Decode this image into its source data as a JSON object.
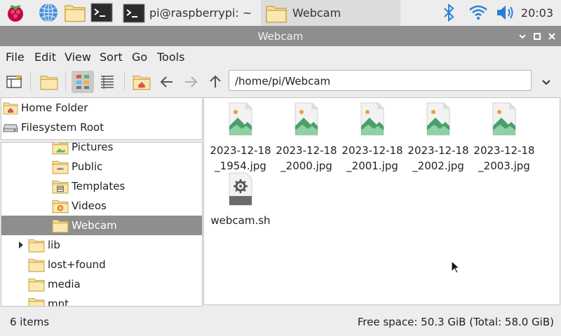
{
  "taskbar": {
    "tasks": [
      {
        "label": "pi@raspberrypi: ~"
      },
      {
        "label": "Webcam"
      }
    ],
    "clock": "20:03",
    "icons": [
      "raspberry-icon",
      "globe-icon",
      "folder-icon",
      "terminal-icon",
      "bluetooth-icon",
      "wifi-icon",
      "volume-icon"
    ]
  },
  "window": {
    "title": "Webcam"
  },
  "menu": {
    "items": [
      "File",
      "Edit",
      "View",
      "Sort",
      "Go",
      "Tools"
    ]
  },
  "toolbar": {
    "path": "/home/pi/Webcam"
  },
  "places": [
    {
      "label": "Home Folder"
    },
    {
      "label": "Filesystem Root"
    }
  ],
  "tree": [
    {
      "label": "Pictures"
    },
    {
      "label": "Public"
    },
    {
      "label": "Templates"
    },
    {
      "label": "Videos"
    },
    {
      "label": "Webcam"
    },
    {
      "label": "lib"
    },
    {
      "label": "lost+found"
    },
    {
      "label": "media"
    },
    {
      "label": "mnt"
    }
  ],
  "files": [
    {
      "line1": "2023-12-18",
      "line2": "_1954.jpg",
      "type": "image"
    },
    {
      "line1": "2023-12-18",
      "line2": "_2000.jpg",
      "type": "image"
    },
    {
      "line1": "2023-12-18",
      "line2": "_2001.jpg",
      "type": "image"
    },
    {
      "line1": "2023-12-18",
      "line2": "_2002.jpg",
      "type": "image"
    },
    {
      "line1": "2023-12-18",
      "line2": "_2003.jpg",
      "type": "image"
    },
    {
      "line1": "webcam.sh",
      "line2": "",
      "type": "script"
    }
  ],
  "status": {
    "count": "6 items",
    "free": "Free space: 50.3 GiB (Total: 58.0 GiB)"
  },
  "colors": {
    "titlebar": "#8e8e8e",
    "selection": "#8e8e8e",
    "folder": "#f5d98b"
  }
}
